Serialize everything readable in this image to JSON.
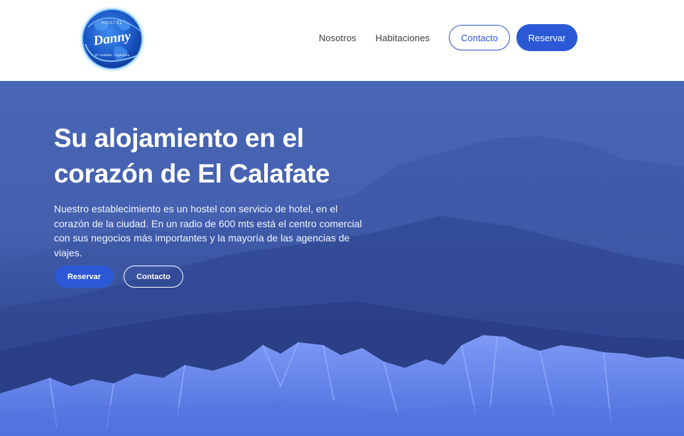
{
  "header": {
    "logo": {
      "top_text": "HOSTEL",
      "name": "Danny",
      "bottom_text": "El Calafate - Argentina",
      "color": "#1f5fd0"
    },
    "nav": {
      "nosotros": "Nosotros",
      "habitaciones": "Habitaciones",
      "contacto": "Contacto",
      "reservar": "Reservar"
    }
  },
  "hero": {
    "title": "Su alojamiento en el corazón de El Calafate",
    "description": "Nuestro establecimiento es un hostel con servicio de hotel, en el corazón de la ciudad. En un radio de 600 mts está el centro comercial con sus negocios más importantes y la mayoría de las agencias de viajes.",
    "buttons": {
      "reservar": "Reservar",
      "contacto": "Contacto"
    },
    "overlay_color": "#3f5fb0"
  },
  "colors": {
    "accent": "#2b59d6",
    "nav_text": "#3a3a3a"
  }
}
